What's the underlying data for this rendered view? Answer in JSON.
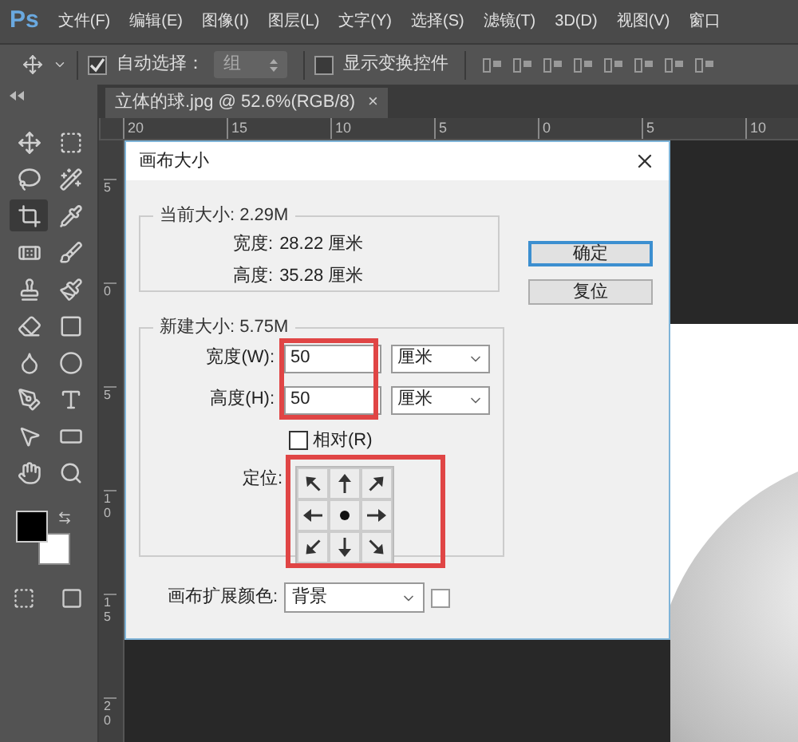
{
  "menu_bar": {
    "logo": "Ps",
    "items": [
      "文件(F)",
      "编辑(E)",
      "图像(I)",
      "图层(L)",
      "文字(Y)",
      "选择(S)",
      "滤镜(T)",
      "3D(D)",
      "视图(V)",
      "窗口"
    ]
  },
  "options_bar": {
    "auto_select": {
      "label": "自动选择：",
      "checked": true
    },
    "auto_select_target": "组",
    "show_transform": {
      "label": "显示变换控件",
      "checked": false
    }
  },
  "tools": [
    {
      "selected": false
    },
    {
      "selected": false
    },
    {
      "selected": false
    },
    {
      "selected": false
    },
    {
      "selected": true
    },
    {
      "selected": false
    },
    {
      "selected": false
    },
    {
      "selected": false
    },
    {
      "selected": false
    },
    {
      "selected": false
    },
    {
      "selected": false
    },
    {
      "selected": false
    },
    {
      "selected": false
    },
    {
      "selected": false
    },
    {
      "selected": false
    },
    {
      "selected": false
    },
    {
      "selected": false
    },
    {
      "selected": false
    },
    {
      "selected": false
    },
    {
      "selected": false
    }
  ],
  "document_tab": {
    "title": "立体的球.jpg @ 52.6%(RGB/8)",
    "close": "×",
    "selected": true
  },
  "rulers": {
    "horizontal": [
      "20",
      "15",
      "10",
      "5",
      "0",
      "5",
      "10"
    ],
    "vertical": [
      "5",
      "0",
      "5",
      "10",
      "15",
      "20"
    ]
  },
  "dialog": {
    "title": "画布大小",
    "current_size": {
      "legend": "当前大小: 2.29M",
      "rows": [
        {
          "label": "宽度:",
          "value": "28.22 厘米"
        },
        {
          "label": "高度:",
          "value": "35.28 厘米"
        }
      ]
    },
    "new_size": {
      "legend": "新建大小: 5.75M",
      "highlighted": true,
      "fields": [
        {
          "label": "宽度(W):",
          "value": "50",
          "unit": "厘米"
        },
        {
          "label": "高度(H):",
          "value": "50",
          "unit": "厘米"
        }
      ],
      "relative": {
        "label": "相对(R)",
        "checked": false
      },
      "anchor": {
        "label": "定位:",
        "highlighted": true,
        "cells": [
          {
            "kind": "nw",
            "selected": false
          },
          {
            "kind": "n",
            "selected": false
          },
          {
            "kind": "ne",
            "selected": false
          },
          {
            "kind": "w",
            "selected": false
          },
          {
            "kind": "c",
            "selected": true
          },
          {
            "kind": "e",
            "selected": false
          },
          {
            "kind": "sw",
            "selected": false
          },
          {
            "kind": "s",
            "selected": false
          },
          {
            "kind": "se",
            "selected": false
          }
        ]
      }
    },
    "extension_color": {
      "label": "画布扩展颜色:",
      "value": "背景",
      "color": "#ffffff"
    },
    "buttons": [
      {
        "label": "确定",
        "default": true
      },
      {
        "label": "复位",
        "default": false
      }
    ]
  }
}
